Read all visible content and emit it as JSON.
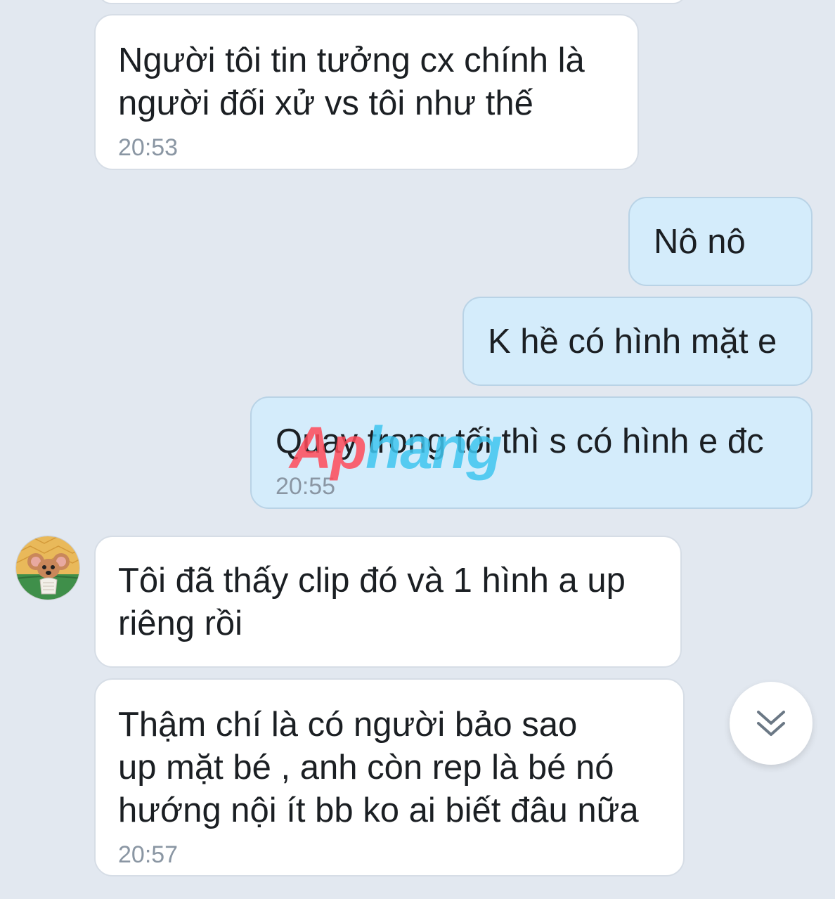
{
  "messages": [
    {
      "id": "m1",
      "side": "incoming",
      "lines": [
        "Người tôi tin tưởng cx chính là",
        "người đối xử vs tôi như thế"
      ],
      "time": "20:53"
    },
    {
      "id": "m2",
      "side": "outgoing",
      "lines": [
        "Nô nô"
      ],
      "time": ""
    },
    {
      "id": "m3",
      "side": "outgoing",
      "lines": [
        "K hề có hình mặt e"
      ],
      "time": ""
    },
    {
      "id": "m4",
      "side": "outgoing",
      "lines": [
        "Quay trong tối thì s có hình e đc"
      ],
      "time": "20:55"
    },
    {
      "id": "m5",
      "side": "incoming",
      "lines": [
        "Tôi đã thấy clip đó và 1 hình a up",
        "riêng rồi"
      ],
      "time": ""
    },
    {
      "id": "m6",
      "side": "incoming",
      "lines": [
        "Thậm chí là có người bảo sao",
        "up mặt bé , anh còn rep là bé nó",
        "hướng nội ít bb ko ai biết đâu nữa"
      ],
      "time": "20:57"
    }
  ],
  "watermark": {
    "part1": "Ap",
    "part2": "hang"
  },
  "icons": {
    "avatar": "cartoon-mouse-avatar",
    "scroll_down": "double-chevron-down-icon"
  },
  "colors": {
    "background": "#e2e8f0",
    "incoming_bubble": "#ffffff",
    "outgoing_bubble": "#d4ecfb",
    "time_text": "#8a96a3",
    "watermark_red": "#ff4a5a",
    "watermark_blue": "#3fc6f0"
  }
}
